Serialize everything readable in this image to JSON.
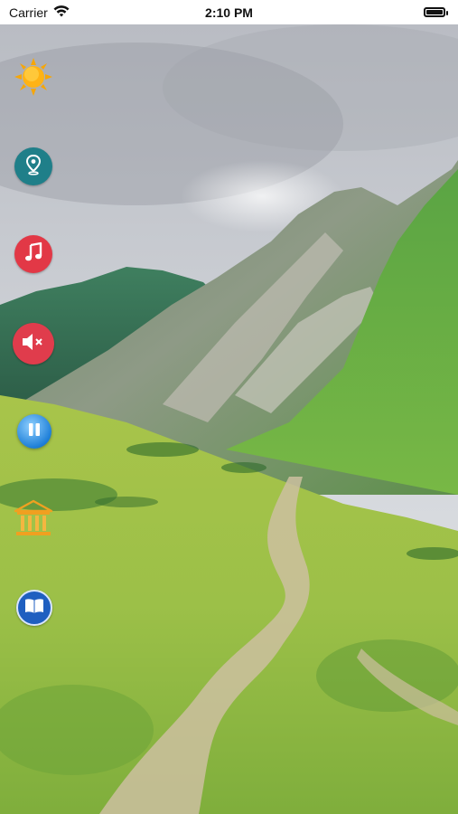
{
  "status_bar": {
    "carrier": "Carrier",
    "time": "2:10 PM",
    "wifi_icon": "wifi-icon",
    "battery_icon": "battery-icon"
  },
  "background": {
    "description_icon": "mountain-landscape-image"
  },
  "side_menu": {
    "items": [
      {
        "name": "weather",
        "icon": "sun-icon"
      },
      {
        "name": "location",
        "icon": "map-pin-icon",
        "color": "#1f7f89"
      },
      {
        "name": "music",
        "icon": "music-note-icon",
        "color": "#e23846"
      },
      {
        "name": "mute",
        "icon": "speaker-mute-icon",
        "color": "#e03c4c"
      },
      {
        "name": "pause",
        "icon": "pause-icon",
        "color": "#1e7fd8"
      },
      {
        "name": "museum",
        "icon": "museum-icon",
        "color": "#f0a020"
      },
      {
        "name": "book",
        "icon": "book-icon",
        "color": "#1f5fc0"
      }
    ]
  }
}
